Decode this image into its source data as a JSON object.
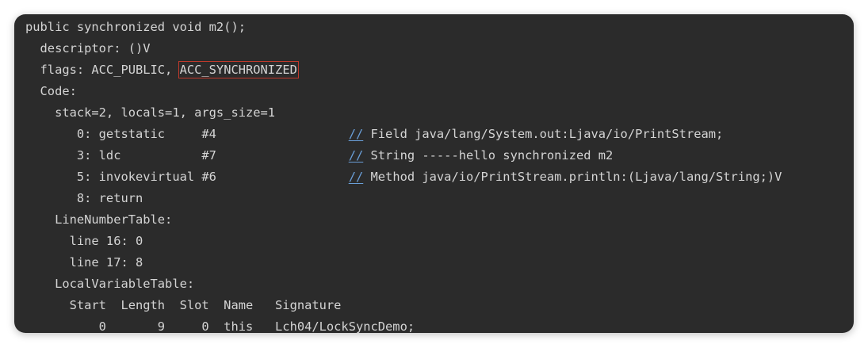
{
  "lines": [
    "public synchronized void m2();",
    "  descriptor: ()V",
    "  flags: ACC_PUBLIC, ",
    "  Code:",
    "    stack=2, locals=1, args_size=1",
    "       0: getstatic     #4                  ",
    "       3: ldc           #7                  ",
    "       5: invokevirtual #6                  ",
    "       8: return",
    "    LineNumberTable:",
    "      line 16: 0",
    "      line 17: 8",
    "    LocalVariableTable:",
    "      Start  Length  Slot  Name   Signature",
    "          0       9     0  this   Lch04/LockSyncDemo;"
  ],
  "highlighted_flag": "ACC_SYNCHRONIZED",
  "comment_marker": "//",
  "comments": {
    "c0": " Field java/lang/System.out:Ljava/io/PrintStream;",
    "c3": " String -----hello synchronized m2",
    "c5": " Method java/io/PrintStream.println:(Ljava/lang/String;)V"
  },
  "colors": {
    "background": "#2b2b2b",
    "text": "#d4d4d4",
    "highlight_box": "#c0392b",
    "comment_marker": "#6a9fd8"
  }
}
